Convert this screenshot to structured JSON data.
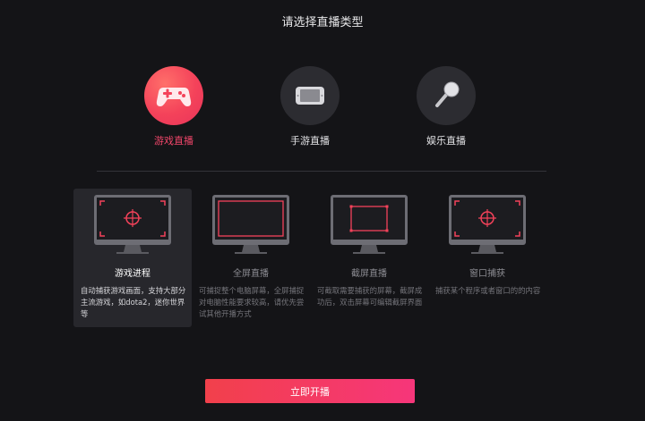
{
  "header": {
    "title": "请选择直播类型"
  },
  "categories": [
    {
      "label": "游戏直播",
      "icon": "gamepad-icon",
      "active": true
    },
    {
      "label": "手游直播",
      "icon": "tablet-icon",
      "active": false
    },
    {
      "label": "娱乐直播",
      "icon": "microphone-icon",
      "active": false
    }
  ],
  "modes": [
    {
      "label": "游戏进程",
      "description": "自动捕获游戏画面，支持大部分主流游戏，如dota2，迷你世界等",
      "icon": "crosshair-monitor-icon",
      "active": true
    },
    {
      "label": "全屏直播",
      "description": "可捕捉整个电脑屏幕，全屏捕捉对电脑性能要求较高，请优先尝试其他开播方式",
      "icon": "fullscreen-monitor-icon",
      "active": false
    },
    {
      "label": "截屏直播",
      "description": "可截取需要捕获的屏幕，截屏成功后，双击屏幕可编辑截屏界面",
      "icon": "region-monitor-icon",
      "active": false
    },
    {
      "label": "窗口捕获",
      "description": "捕获某个程序或者窗口的的内容",
      "icon": "crosshair-monitor-icon",
      "active": false
    }
  ],
  "actions": {
    "start_label": "立即开播"
  },
  "colors": {
    "accent": "#f0466a",
    "background": "#141417",
    "button_start": "#f2404b",
    "button_end": "#f6367a"
  }
}
